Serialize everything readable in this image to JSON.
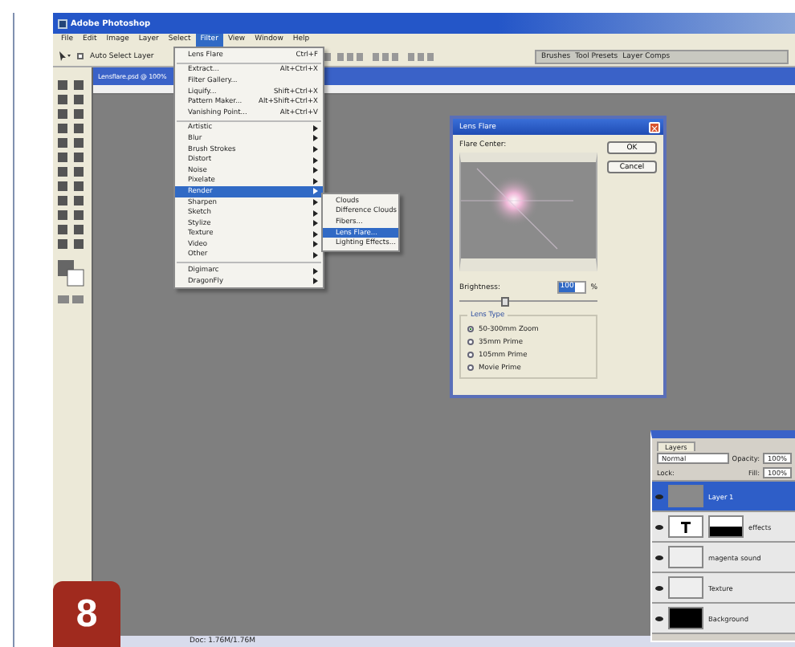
{
  "window": {
    "title": "Adobe Photoshop"
  },
  "menu_bar": [
    {
      "label": "File",
      "selected": false
    },
    {
      "label": "Edit",
      "selected": false
    },
    {
      "label": "Image",
      "selected": false
    },
    {
      "label": "Layer",
      "selected": false
    },
    {
      "label": "Select",
      "selected": false
    },
    {
      "label": "Filter",
      "selected": true
    },
    {
      "label": "View",
      "selected": false
    },
    {
      "label": "Window",
      "selected": false
    },
    {
      "label": "Help",
      "selected": false
    }
  ],
  "options_bar": {
    "auto_select": {
      "label": "Auto Select Layer",
      "checked": false
    },
    "palette_tabs": [
      "Brushes",
      "Tool Presets",
      "Layer Comps"
    ]
  },
  "document": {
    "title": "Lensflare.psd @ 100%",
    "status": "Doc: 1.76M/1.76M"
  },
  "filter_menu": [
    {
      "kind": "item",
      "label": "Lens Flare",
      "shortcut": "Ctrl+F",
      "selected": false
    },
    {
      "kind": "separator"
    },
    {
      "kind": "item",
      "label": "Extract...",
      "shortcut": "Alt+Ctrl+X",
      "selected": false
    },
    {
      "kind": "item",
      "label": "Filter Gallery...",
      "selected": false
    },
    {
      "kind": "item",
      "label": "Liquify...",
      "shortcut": "Shift+Ctrl+X",
      "selected": false
    },
    {
      "kind": "item",
      "label": "Pattern Maker...",
      "shortcut": "Alt+Shift+Ctrl+X",
      "selected": false
    },
    {
      "kind": "item",
      "label": "Vanishing Point...",
      "shortcut": "Alt+Ctrl+V",
      "selected": false
    },
    {
      "kind": "separator"
    },
    {
      "kind": "submenu",
      "label": "Artistic",
      "selected": false
    },
    {
      "kind": "submenu",
      "label": "Blur",
      "selected": false
    },
    {
      "kind": "submenu",
      "label": "Brush Strokes",
      "selected": false
    },
    {
      "kind": "submenu",
      "label": "Distort",
      "selected": false
    },
    {
      "kind": "submenu",
      "label": "Noise",
      "selected": false
    },
    {
      "kind": "submenu",
      "label": "Pixelate",
      "selected": false
    },
    {
      "kind": "submenu",
      "label": "Render",
      "selected": true
    },
    {
      "kind": "submenu",
      "label": "Sharpen",
      "selected": false
    },
    {
      "kind": "submenu",
      "label": "Sketch",
      "selected": false
    },
    {
      "kind": "submenu",
      "label": "Stylize",
      "selected": false
    },
    {
      "kind": "submenu",
      "label": "Texture",
      "selected": false
    },
    {
      "kind": "submenu",
      "label": "Video",
      "selected": false
    },
    {
      "kind": "submenu",
      "label": "Other",
      "selected": false
    },
    {
      "kind": "separator"
    },
    {
      "kind": "submenu",
      "label": "Digimarc",
      "selected": false
    },
    {
      "kind": "submenu",
      "label": "DragonFly",
      "selected": false
    }
  ],
  "render_submenu": [
    {
      "label": "Clouds",
      "selected": false
    },
    {
      "label": "Difference Clouds",
      "selected": false
    },
    {
      "label": "Fibers...",
      "selected": false
    },
    {
      "label": "Lens Flare...",
      "selected": true
    },
    {
      "label": "Lighting Effects...",
      "selected": false
    }
  ],
  "lens_flare_dialog": {
    "title": "Lens Flare",
    "close": "×",
    "flare_center_label": "Flare Center:",
    "buttons": [
      "OK",
      "Cancel"
    ],
    "brightness_label": "Brightness:",
    "brightness_value": "100",
    "brightness_unit": "%",
    "brightness_slider": {
      "level": 0.33
    },
    "lens_type_label": "Lens Type",
    "lens_types": [
      {
        "label": "50-300mm Zoom",
        "selected": true
      },
      {
        "label": "35mm Prime",
        "selected": false
      },
      {
        "label": "105mm Prime",
        "selected": false
      },
      {
        "label": "Movie Prime",
        "selected": false
      }
    ]
  },
  "layers_panel": {
    "tab": "Layers",
    "blend_mode": "Normal",
    "opacity_label": "Opacity:",
    "opacity": "100%",
    "lock_label": "Lock:",
    "fill_label": "Fill:",
    "fill": "100%",
    "layers": [
      {
        "name": "Layer 1",
        "kind": "gray",
        "selected": true
      },
      {
        "name": "effects",
        "kind": "text",
        "selected": false
      },
      {
        "name": "magenta sound",
        "kind": "light",
        "selected": false
      },
      {
        "name": "Texture",
        "kind": "light",
        "selected": false
      },
      {
        "name": "Background",
        "kind": "black",
        "selected": false
      }
    ]
  },
  "step_badge": "8"
}
